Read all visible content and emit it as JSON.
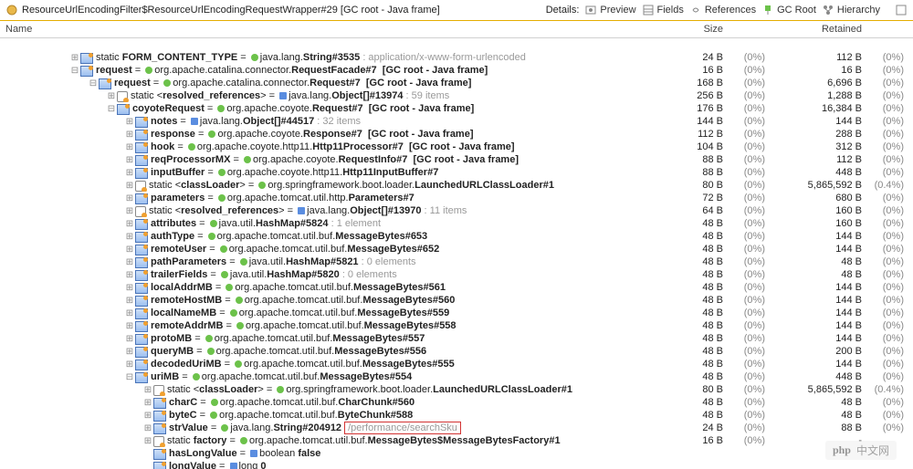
{
  "toolbar": {
    "breadcrumb": "ResourceUrlEncodingFilter$ResourceUrlEncodingRequestWrapper#29 [GC root - Java frame]",
    "details_label": "Details:",
    "buttons": {
      "preview": "Preview",
      "fields": "Fields",
      "references": "References",
      "gcroot": "GC Root",
      "hierarchy": "Hierarchy"
    }
  },
  "columns": {
    "name": "Name",
    "size": "Size",
    "retained": "Retained"
  },
  "blank_rows_top": 1,
  "rows": [
    {
      "indent": 76,
      "toggle": "plus",
      "icon": "bluefield",
      "segs": [
        {
          "t": "static "
        },
        {
          "t": "FORM_CONTENT_TYPE",
          "b": true
        },
        {
          "t": " = "
        },
        {
          "ic": "green"
        },
        {
          "t": "java.lang."
        },
        {
          "t": "String#3535",
          "b": true
        },
        {
          "t": " : application/x-www-form-urlencoded",
          "cls": "dim"
        }
      ],
      "size": "24 B",
      "sp": "(0%)",
      "ret": "112 B",
      "rp": "(0%)"
    },
    {
      "indent": 76,
      "toggle": "minus",
      "icon": "bluefield",
      "segs": [
        {
          "t": "request",
          "b": true
        },
        {
          "t": " = "
        },
        {
          "ic": "green"
        },
        {
          "t": "org.apache.catalina.connector."
        },
        {
          "t": "RequestFacade#7",
          "b": true
        },
        {
          "t": "  [GC root - Java frame]",
          "b": true
        }
      ],
      "size": "16 B",
      "sp": "(0%)",
      "ret": "16 B",
      "rp": "(0%)"
    },
    {
      "indent": 96,
      "toggle": "minus",
      "icon": "bluefield",
      "segs": [
        {
          "t": "request",
          "b": true
        },
        {
          "t": " = "
        },
        {
          "ic": "green"
        },
        {
          "t": "org.apache.catalina.connector."
        },
        {
          "t": "Request#7",
          "b": true
        },
        {
          "t": "  [GC root - Java frame]",
          "b": true
        }
      ],
      "size": "168 B",
      "sp": "(0%)",
      "ret": "6,696 B",
      "rp": "(0%)"
    },
    {
      "indent": 116,
      "toggle": "plus",
      "icon": "method",
      "segs": [
        {
          "t": "static <"
        },
        {
          "t": "resolved_references",
          "b": true
        },
        {
          "t": "> = "
        },
        {
          "ic": "rect"
        },
        {
          "t": "java.lang."
        },
        {
          "t": "Object[]#13974",
          "b": true
        },
        {
          "t": " : 59 items",
          "cls": "dim"
        }
      ],
      "size": "256 B",
      "sp": "(0%)",
      "ret": "1,288 B",
      "rp": "(0%)"
    },
    {
      "indent": 116,
      "toggle": "minus",
      "icon": "bluefield",
      "segs": [
        {
          "t": "coyoteRequest",
          "b": true
        },
        {
          "t": " = "
        },
        {
          "ic": "green"
        },
        {
          "t": "org.apache.coyote."
        },
        {
          "t": "Request#7",
          "b": true
        },
        {
          "t": "  [GC root - Java frame]",
          "b": true
        }
      ],
      "size": "176 B",
      "sp": "(0%)",
      "ret": "16,384 B",
      "rp": "(0%)"
    },
    {
      "indent": 136,
      "toggle": "plus",
      "icon": "bluefield",
      "segs": [
        {
          "t": "notes",
          "b": true
        },
        {
          "t": " = "
        },
        {
          "ic": "rect"
        },
        {
          "t": "java.lang."
        },
        {
          "t": "Object[]#44517",
          "b": true
        },
        {
          "t": " : 32 items",
          "cls": "dim"
        }
      ],
      "size": "144 B",
      "sp": "(0%)",
      "ret": "144 B",
      "rp": "(0%)"
    },
    {
      "indent": 136,
      "toggle": "plus",
      "icon": "bluefield",
      "segs": [
        {
          "t": "response",
          "b": true
        },
        {
          "t": " = "
        },
        {
          "ic": "green"
        },
        {
          "t": "org.apache.coyote."
        },
        {
          "t": "Response#7",
          "b": true
        },
        {
          "t": "  [GC root - Java frame]",
          "b": true
        }
      ],
      "size": "112 B",
      "sp": "(0%)",
      "ret": "288 B",
      "rp": "(0%)"
    },
    {
      "indent": 136,
      "toggle": "plus",
      "icon": "bluefield",
      "segs": [
        {
          "t": "hook",
          "b": true
        },
        {
          "t": " = "
        },
        {
          "ic": "green"
        },
        {
          "t": "org.apache.coyote.http11."
        },
        {
          "t": "Http11Processor#7",
          "b": true
        },
        {
          "t": "  [GC root - Java frame]",
          "b": true
        }
      ],
      "size": "104 B",
      "sp": "(0%)",
      "ret": "312 B",
      "rp": "(0%)"
    },
    {
      "indent": 136,
      "toggle": "plus",
      "icon": "bluefield",
      "segs": [
        {
          "t": "reqProcessorMX",
          "b": true
        },
        {
          "t": " = "
        },
        {
          "ic": "green"
        },
        {
          "t": "org.apache.coyote."
        },
        {
          "t": "RequestInfo#7",
          "b": true
        },
        {
          "t": "  [GC root - Java frame]",
          "b": true
        }
      ],
      "size": "88 B",
      "sp": "(0%)",
      "ret": "112 B",
      "rp": "(0%)"
    },
    {
      "indent": 136,
      "toggle": "plus",
      "icon": "bluefield",
      "segs": [
        {
          "t": "inputBuffer",
          "b": true
        },
        {
          "t": " = "
        },
        {
          "ic": "green"
        },
        {
          "t": "org.apache.coyote.http11."
        },
        {
          "t": "Http11InputBuffer#7",
          "b": true
        }
      ],
      "size": "88 B",
      "sp": "(0%)",
      "ret": "448 B",
      "rp": "(0%)"
    },
    {
      "indent": 136,
      "toggle": "plus",
      "icon": "method",
      "segs": [
        {
          "t": "static <"
        },
        {
          "t": "classLoader",
          "b": true
        },
        {
          "t": "> = "
        },
        {
          "ic": "green"
        },
        {
          "t": "org.springframework.boot.loader."
        },
        {
          "t": "LaunchedURLClassLoader#1",
          "b": true
        }
      ],
      "size": "80 B",
      "sp": "(0%)",
      "ret": "5,865,592 B",
      "rp": "(0.4%)"
    },
    {
      "indent": 136,
      "toggle": "plus",
      "icon": "bluefield",
      "segs": [
        {
          "t": "parameters",
          "b": true
        },
        {
          "t": " = "
        },
        {
          "ic": "green"
        },
        {
          "t": "org.apache.tomcat.util.http."
        },
        {
          "t": "Parameters#7",
          "b": true
        }
      ],
      "size": "72 B",
      "sp": "(0%)",
      "ret": "680 B",
      "rp": "(0%)"
    },
    {
      "indent": 136,
      "toggle": "plus",
      "icon": "method",
      "segs": [
        {
          "t": "static <"
        },
        {
          "t": "resolved_references",
          "b": true
        },
        {
          "t": "> = "
        },
        {
          "ic": "rect"
        },
        {
          "t": "java.lang."
        },
        {
          "t": "Object[]#13970",
          "b": true
        },
        {
          "t": " : 11 items",
          "cls": "dim"
        }
      ],
      "size": "64 B",
      "sp": "(0%)",
      "ret": "160 B",
      "rp": "(0%)"
    },
    {
      "indent": 136,
      "toggle": "plus",
      "icon": "bluefield",
      "segs": [
        {
          "t": "attributes",
          "b": true
        },
        {
          "t": " = "
        },
        {
          "ic": "green"
        },
        {
          "t": "java.util."
        },
        {
          "t": "HashMap#5824",
          "b": true
        },
        {
          "t": " : 1 element",
          "cls": "dim"
        }
      ],
      "size": "48 B",
      "sp": "(0%)",
      "ret": "160 B",
      "rp": "(0%)"
    },
    {
      "indent": 136,
      "toggle": "plus",
      "icon": "bluefield",
      "segs": [
        {
          "t": "authType",
          "b": true
        },
        {
          "t": " = "
        },
        {
          "ic": "green"
        },
        {
          "t": "org.apache.tomcat.util.buf."
        },
        {
          "t": "MessageBytes#653",
          "b": true
        }
      ],
      "size": "48 B",
      "sp": "(0%)",
      "ret": "144 B",
      "rp": "(0%)"
    },
    {
      "indent": 136,
      "toggle": "plus",
      "icon": "bluefield",
      "segs": [
        {
          "t": "remoteUser",
          "b": true
        },
        {
          "t": " = "
        },
        {
          "ic": "green"
        },
        {
          "t": "org.apache.tomcat.util.buf."
        },
        {
          "t": "MessageBytes#652",
          "b": true
        }
      ],
      "size": "48 B",
      "sp": "(0%)",
      "ret": "144 B",
      "rp": "(0%)"
    },
    {
      "indent": 136,
      "toggle": "plus",
      "icon": "bluefield",
      "segs": [
        {
          "t": "pathParameters",
          "b": true
        },
        {
          "t": " = "
        },
        {
          "ic": "green"
        },
        {
          "t": "java.util."
        },
        {
          "t": "HashMap#5821",
          "b": true
        },
        {
          "t": " : 0 elements",
          "cls": "dim"
        }
      ],
      "size": "48 B",
      "sp": "(0%)",
      "ret": "48 B",
      "rp": "(0%)"
    },
    {
      "indent": 136,
      "toggle": "plus",
      "icon": "bluefield",
      "segs": [
        {
          "t": "trailerFields",
          "b": true
        },
        {
          "t": " = "
        },
        {
          "ic": "green"
        },
        {
          "t": "java.util."
        },
        {
          "t": "HashMap#5820",
          "b": true
        },
        {
          "t": " : 0 elements",
          "cls": "dim"
        }
      ],
      "size": "48 B",
      "sp": "(0%)",
      "ret": "48 B",
      "rp": "(0%)"
    },
    {
      "indent": 136,
      "toggle": "plus",
      "icon": "bluefield",
      "segs": [
        {
          "t": "localAddrMB",
          "b": true
        },
        {
          "t": " = "
        },
        {
          "ic": "green"
        },
        {
          "t": "org.apache.tomcat.util.buf."
        },
        {
          "t": "MessageBytes#561",
          "b": true
        }
      ],
      "size": "48 B",
      "sp": "(0%)",
      "ret": "144 B",
      "rp": "(0%)"
    },
    {
      "indent": 136,
      "toggle": "plus",
      "icon": "bluefield",
      "segs": [
        {
          "t": "remoteHostMB",
          "b": true
        },
        {
          "t": " = "
        },
        {
          "ic": "green"
        },
        {
          "t": "org.apache.tomcat.util.buf."
        },
        {
          "t": "MessageBytes#560",
          "b": true
        }
      ],
      "size": "48 B",
      "sp": "(0%)",
      "ret": "144 B",
      "rp": "(0%)"
    },
    {
      "indent": 136,
      "toggle": "plus",
      "icon": "bluefield",
      "segs": [
        {
          "t": "localNameMB",
          "b": true
        },
        {
          "t": " = "
        },
        {
          "ic": "green"
        },
        {
          "t": "org.apache.tomcat.util.buf."
        },
        {
          "t": "MessageBytes#559",
          "b": true
        }
      ],
      "size": "48 B",
      "sp": "(0%)",
      "ret": "144 B",
      "rp": "(0%)"
    },
    {
      "indent": 136,
      "toggle": "plus",
      "icon": "bluefield",
      "segs": [
        {
          "t": "remoteAddrMB",
          "b": true
        },
        {
          "t": " = "
        },
        {
          "ic": "green"
        },
        {
          "t": "org.apache.tomcat.util.buf."
        },
        {
          "t": "MessageBytes#558",
          "b": true
        }
      ],
      "size": "48 B",
      "sp": "(0%)",
      "ret": "144 B",
      "rp": "(0%)"
    },
    {
      "indent": 136,
      "toggle": "plus",
      "icon": "bluefield",
      "segs": [
        {
          "t": "protoMB",
          "b": true
        },
        {
          "t": " = "
        },
        {
          "ic": "green"
        },
        {
          "t": "org.apache.tomcat.util.buf."
        },
        {
          "t": "MessageBytes#557",
          "b": true
        }
      ],
      "size": "48 B",
      "sp": "(0%)",
      "ret": "144 B",
      "rp": "(0%)"
    },
    {
      "indent": 136,
      "toggle": "plus",
      "icon": "bluefield",
      "segs": [
        {
          "t": "queryMB",
          "b": true
        },
        {
          "t": " = "
        },
        {
          "ic": "green"
        },
        {
          "t": "org.apache.tomcat.util.buf."
        },
        {
          "t": "MessageBytes#556",
          "b": true
        }
      ],
      "size": "48 B",
      "sp": "(0%)",
      "ret": "200 B",
      "rp": "(0%)"
    },
    {
      "indent": 136,
      "toggle": "plus",
      "icon": "bluefield",
      "segs": [
        {
          "t": "decodedUriMB",
          "b": true
        },
        {
          "t": " = "
        },
        {
          "ic": "green"
        },
        {
          "t": "org.apache.tomcat.util.buf."
        },
        {
          "t": "MessageBytes#555",
          "b": true
        }
      ],
      "size": "48 B",
      "sp": "(0%)",
      "ret": "144 B",
      "rp": "(0%)"
    },
    {
      "indent": 136,
      "toggle": "minus",
      "icon": "bluefield",
      "segs": [
        {
          "t": "uriMB",
          "b": true
        },
        {
          "t": " = "
        },
        {
          "ic": "green"
        },
        {
          "t": "org.apache.tomcat.util.buf."
        },
        {
          "t": "MessageBytes#554",
          "b": true
        }
      ],
      "size": "48 B",
      "sp": "(0%)",
      "ret": "448 B",
      "rp": "(0%)"
    },
    {
      "indent": 156,
      "toggle": "plus",
      "icon": "method",
      "segs": [
        {
          "t": "static <"
        },
        {
          "t": "classLoader",
          "b": true
        },
        {
          "t": "> = "
        },
        {
          "ic": "green"
        },
        {
          "t": "org.springframework.boot.loader."
        },
        {
          "t": "LaunchedURLClassLoader#1",
          "b": true
        }
      ],
      "size": "80 B",
      "sp": "(0%)",
      "ret": "5,865,592 B",
      "rp": "(0.4%)"
    },
    {
      "indent": 156,
      "toggle": "plus",
      "icon": "bluefield",
      "segs": [
        {
          "t": "charC",
          "b": true
        },
        {
          "t": " = "
        },
        {
          "ic": "green"
        },
        {
          "t": "org.apache.tomcat.util.buf."
        },
        {
          "t": "CharChunk#560",
          "b": true
        }
      ],
      "size": "48 B",
      "sp": "(0%)",
      "ret": "48 B",
      "rp": "(0%)"
    },
    {
      "indent": 156,
      "toggle": "plus",
      "icon": "bluefield",
      "segs": [
        {
          "t": "byteC",
          "b": true
        },
        {
          "t": " = "
        },
        {
          "ic": "green"
        },
        {
          "t": "org.apache.tomcat.util.buf."
        },
        {
          "t": "ByteChunk#588",
          "b": true
        }
      ],
      "size": "48 B",
      "sp": "(0%)",
      "ret": "48 B",
      "rp": "(0%)"
    },
    {
      "indent": 156,
      "toggle": "plus",
      "icon": "bluefield",
      "segs": [
        {
          "t": "strValue",
          "b": true
        },
        {
          "t": " = "
        },
        {
          "ic": "green"
        },
        {
          "t": "java.lang."
        },
        {
          "t": "String#204912",
          "b": true
        },
        {
          "hl": "/performance/searchSku"
        }
      ],
      "size": "24 B",
      "sp": "(0%)",
      "ret": "88 B",
      "rp": "(0%)"
    },
    {
      "indent": 156,
      "toggle": "plus",
      "icon": "method",
      "segs": [
        {
          "t": "static "
        },
        {
          "t": "factory",
          "b": true
        },
        {
          "t": " = "
        },
        {
          "ic": "green"
        },
        {
          "t": "org.apache.tomcat.util.buf."
        },
        {
          "t": "MessageBytes$MessageBytesFactory#1",
          "b": true
        }
      ],
      "size": "16 B",
      "sp": "(0%)",
      "ret": "-",
      "rp": ""
    },
    {
      "indent": 156,
      "toggle": "",
      "icon": "bluefield",
      "segs": [
        {
          "t": "hasLongValue",
          "b": true
        },
        {
          "t": " = "
        },
        {
          "ic": "rect"
        },
        {
          "t": "boolean "
        },
        {
          "t": "false",
          "b": true
        }
      ],
      "size": "",
      "sp": "",
      "ret": "",
      "rp": ""
    },
    {
      "indent": 156,
      "toggle": "",
      "icon": "bluefield",
      "segs": [
        {
          "t": "longValue",
          "b": true
        },
        {
          "t": " = "
        },
        {
          "ic": "rect"
        },
        {
          "t": "long "
        },
        {
          "t": "0",
          "b": true
        }
      ],
      "size": "",
      "sp": "",
      "ret": "",
      "rp": ""
    }
  ],
  "watermark": {
    "logo": "php",
    "text": "中文网"
  }
}
